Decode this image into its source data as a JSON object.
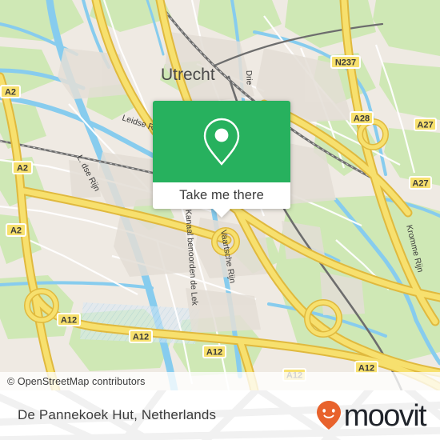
{
  "map": {
    "provider_attribution": "© OpenStreetMap contributors",
    "city_label": "Utrecht",
    "water_labels": [
      {
        "name": "Leidse Rijn"
      },
      {
        "name": "L. dse Rijn"
      },
      {
        "name": "Drie"
      },
      {
        "name": "Vaartsche Rijn"
      },
      {
        "name": "Kanaal benoorden de Lek"
      },
      {
        "name": "Kromme Rijn"
      }
    ],
    "road_shields": [
      {
        "label": "N237"
      },
      {
        "label": "A28"
      },
      {
        "label": "A27"
      },
      {
        "label": "A27"
      },
      {
        "label": "A2"
      },
      {
        "label": "A2"
      },
      {
        "label": "A2"
      },
      {
        "label": "A12"
      },
      {
        "label": "A12"
      },
      {
        "label": "A12"
      },
      {
        "label": "A12"
      },
      {
        "label": "A12"
      }
    ],
    "colors": {
      "land": "#efeae3",
      "green": "#cfe8b5",
      "water": "#87ccee",
      "motorway": "#f7e06e",
      "road_casing": "#e8c34a",
      "rail": "#6d6d6d",
      "shield_fill": "#f7e06e",
      "shield_text": "#3a3a3a"
    }
  },
  "callout": {
    "button_label": "Take me there",
    "pin_icon": "map-pin-icon",
    "accent_color": "#27b15e"
  },
  "footer": {
    "title": "De Pannekoek Hut, Netherlands",
    "brand_name": "moovit",
    "brand_icon": "moovit-smiley-pin-icon",
    "brand_icon_color": "#e8622c",
    "brand_text_color": "#20242b"
  }
}
